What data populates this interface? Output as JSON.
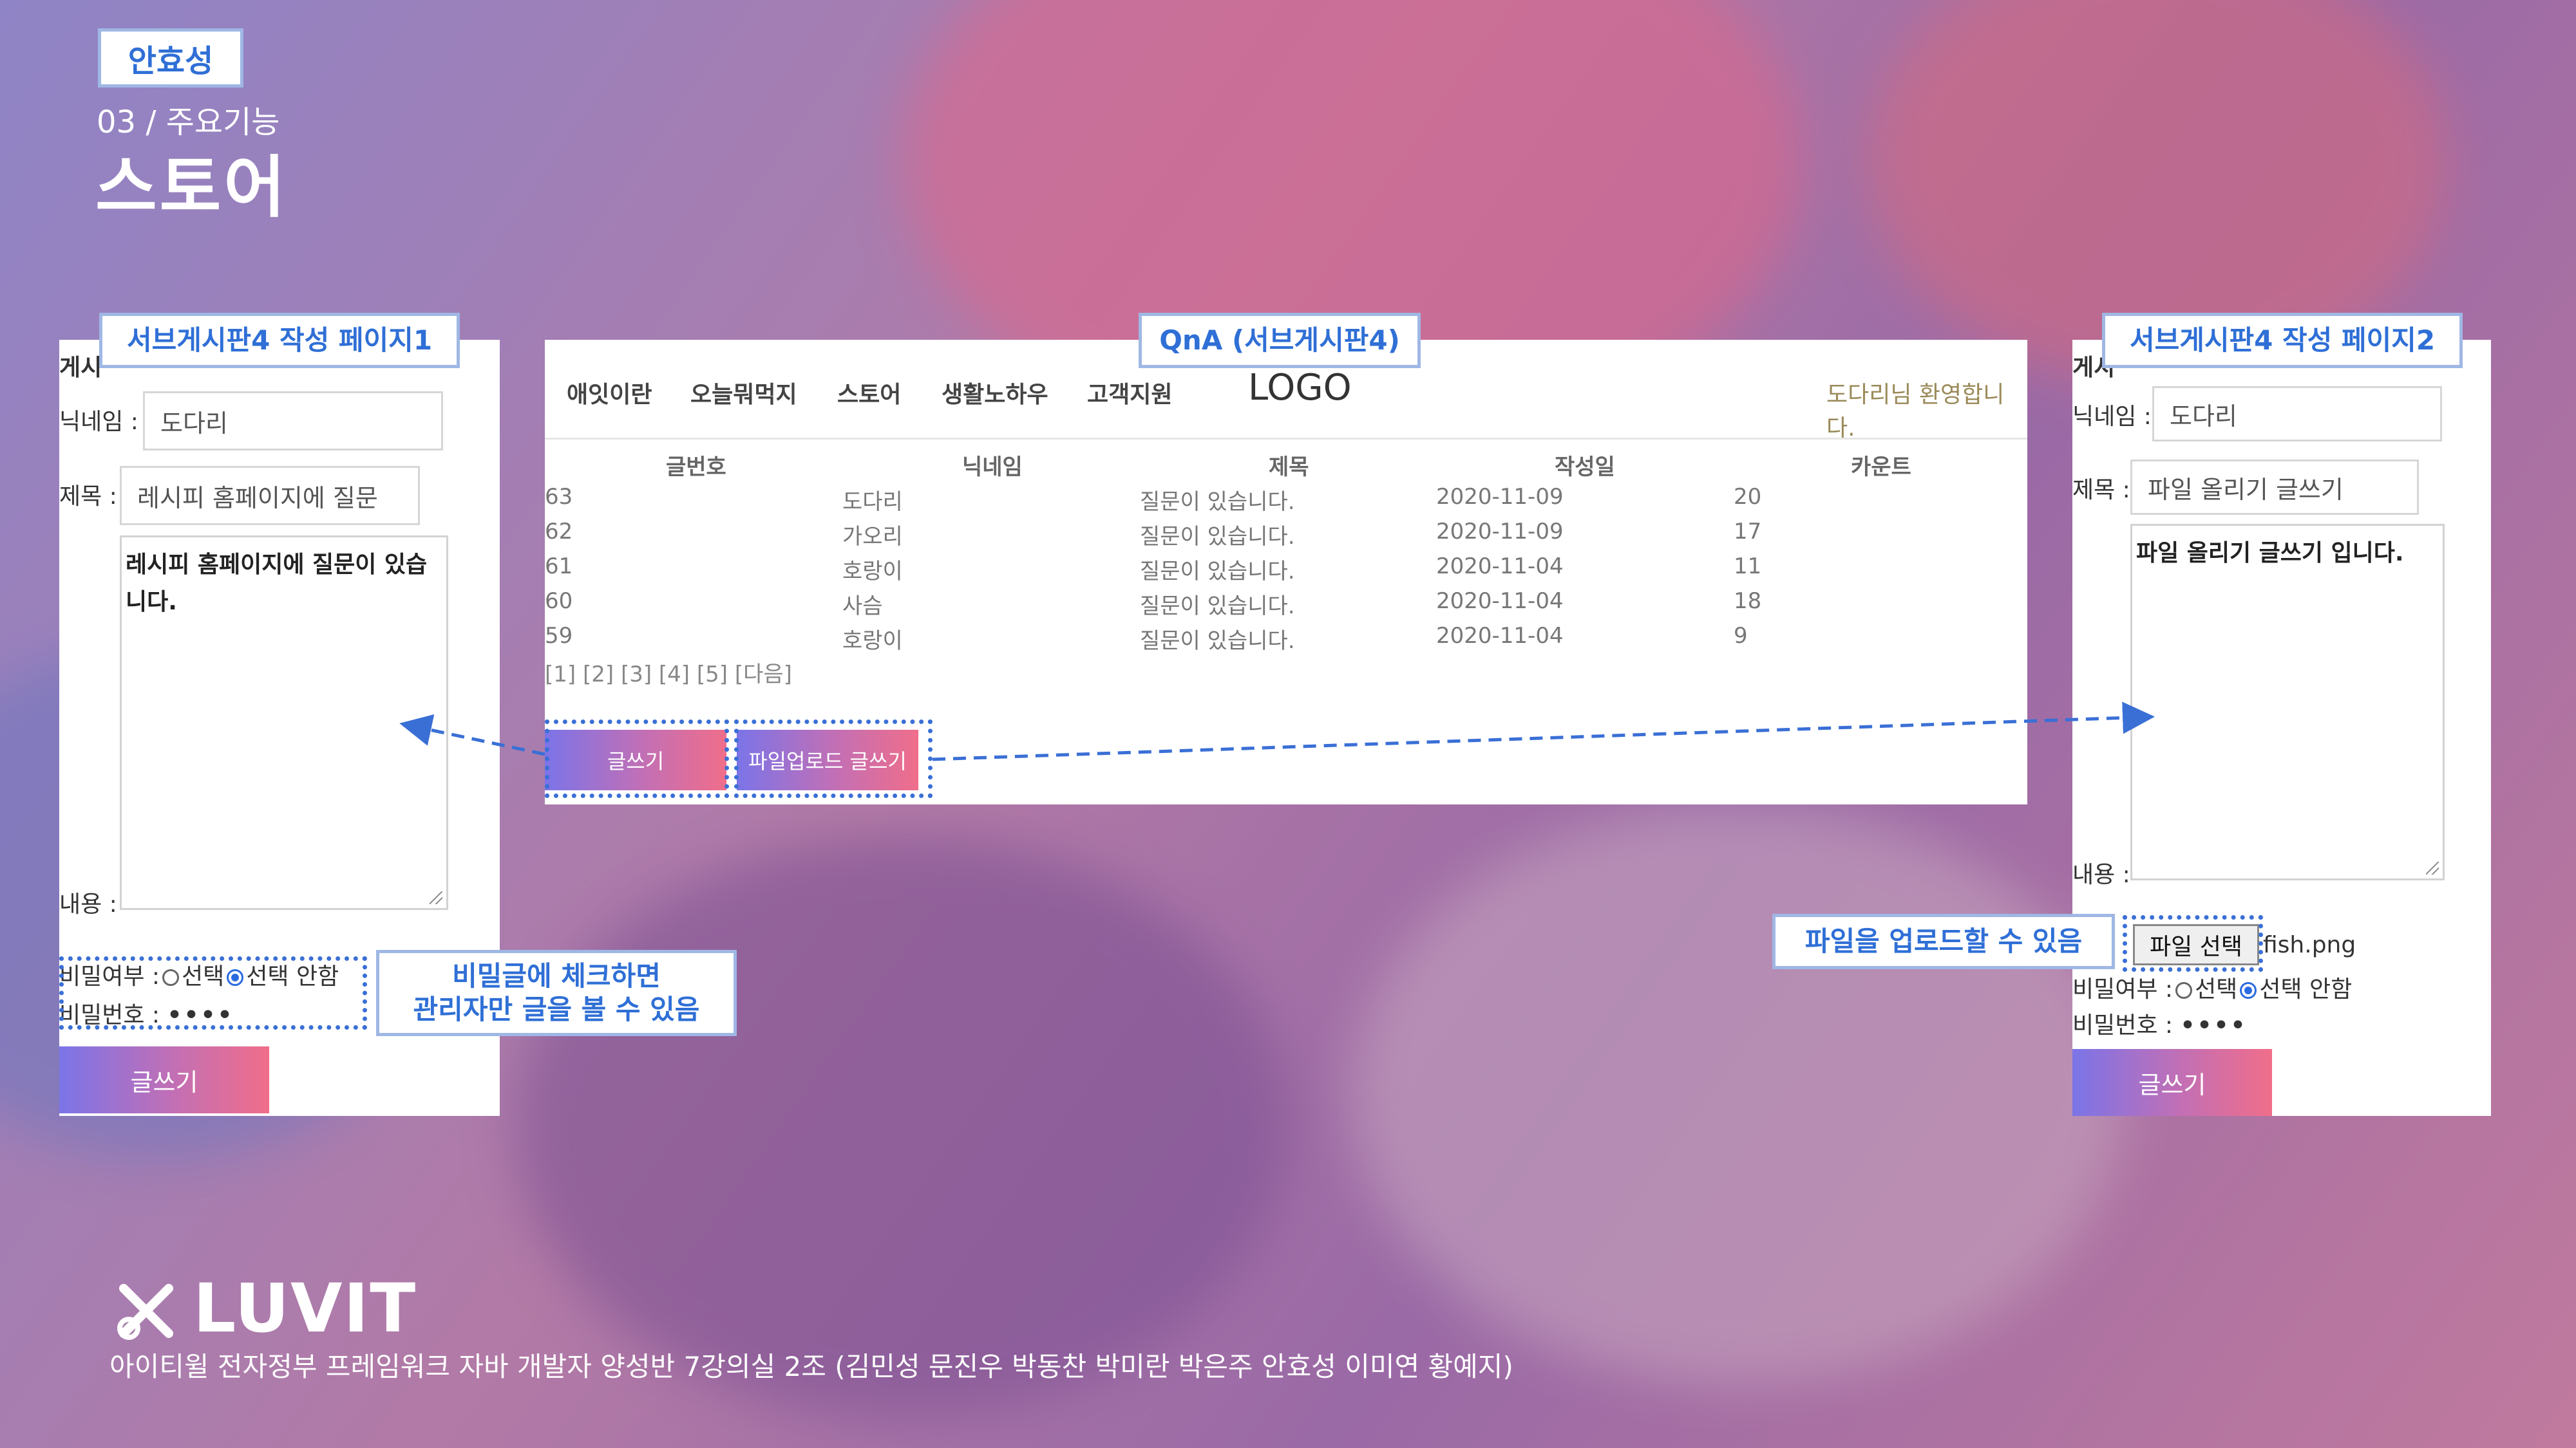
{
  "header": {
    "author_tag": "안효성",
    "section": "03 / 주요기능",
    "title": "스토어"
  },
  "left_panel": {
    "caption": "서브게시판4 작성 페이지1",
    "partial_heading": "게시",
    "nickname_label": "닉네임 :",
    "nickname_value": "도다리",
    "subject_label": "제목 :",
    "subject_value": "레시피 홈페이지에 질문",
    "content_value": "레시피 홈페이지에 질문이 있습니다.",
    "content_label": "내용 :",
    "secret_label": "비밀여부 :",
    "radio_option_1": "선택",
    "radio_option_2": "선택 안함",
    "password_label": "비밀번호 :",
    "password_value": "••••",
    "submit_label": "글쓰기"
  },
  "secret_callout": {
    "line1": "비밀글에 체크하면",
    "line2": "관리자만 글을 볼 수 있음"
  },
  "qna_panel": {
    "caption": "QnA (서브게시판4)",
    "nav": [
      "애잇이란",
      "오늘뭐먹지",
      "스토어",
      "생활노하우",
      "고객지원"
    ],
    "logo": "LOGO",
    "welcome": "도다리님 환영합니다.",
    "columns": [
      "글번호",
      "닉네임",
      "제목",
      "작성일",
      "카운트"
    ],
    "rows": [
      [
        "63",
        "도다리",
        "질문이 있습니다.",
        "2020-11-09",
        "20"
      ],
      [
        "62",
        "가오리",
        "질문이 있습니다.",
        "2020-11-09",
        "17"
      ],
      [
        "61",
        "호랑이",
        "질문이 있습니다.",
        "2020-11-04",
        "11"
      ],
      [
        "60",
        "사슴",
        "질문이 있습니다.",
        "2020-11-04",
        "18"
      ],
      [
        "59",
        "호랑이",
        "질문이 있습니다.",
        "2020-11-04",
        "9"
      ]
    ],
    "pagination": "[1] [2] [3] [4] [5] [다음]",
    "write_button": "글쓰기",
    "upload_write_button": "파일업로드 글쓰기"
  },
  "right_panel": {
    "caption": "서브게시판4 작성 페이지2",
    "partial_heading": "게시",
    "nickname_label": "닉네임 :",
    "nickname_value": "도다리",
    "subject_label": "제목 :",
    "subject_value": "파일 올리기 글쓰기",
    "content_value": "파일 올리기 글쓰기 입니다.",
    "content_label": "내용 :",
    "file_button": "파일 선택",
    "file_name": "fish.png",
    "secret_label": "비밀여부 :",
    "radio_option_1": "선택",
    "radio_option_2": "선택 안함",
    "password_label": "비밀번호 :",
    "password_value": "••••",
    "submit_label": "글쓰기"
  },
  "upload_callout": "파일을 업로드할 수 있음",
  "footer": {
    "brand": "LUVIT",
    "credits": "아이티윌 전자정부 프레임워크 자바 개발자 양성반 7강의실 2조 (김민성 문진우 박동찬 박미란 박은주 안효성 이미연 황예지)"
  },
  "colors": {
    "accent_blue": "#2f6fd6",
    "button_gradient_start": "#7b74e8",
    "button_gradient_end": "#f06e8a"
  }
}
